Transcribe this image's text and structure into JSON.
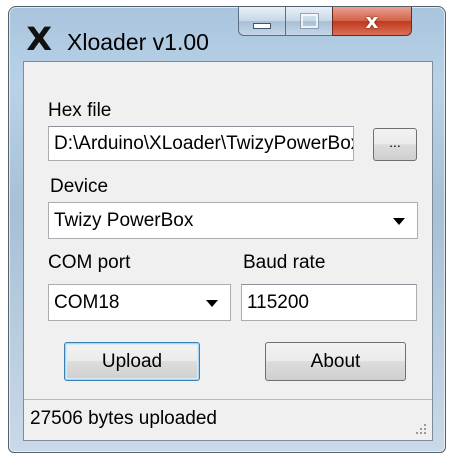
{
  "window": {
    "title": "Xloader v1.00",
    "app_icon_glyph": "X",
    "close_glyph": "x",
    "colors": {
      "close_button": "#c2391b",
      "default_button_border": "#3c7fb1"
    }
  },
  "form": {
    "hex_file_label": "Hex file",
    "hex_file_value": "D:\\Arduino\\XLoader\\TwizyPowerBox.hex",
    "browse_label": "...",
    "device_label": "Device",
    "device_selected": "Twizy PowerBox",
    "com_port_label": "COM port",
    "com_port_selected": "COM18",
    "baud_rate_label": "Baud rate",
    "baud_rate_value": "115200",
    "upload_label": "Upload",
    "about_label": "About"
  },
  "status": {
    "text": "27506 bytes uploaded"
  }
}
